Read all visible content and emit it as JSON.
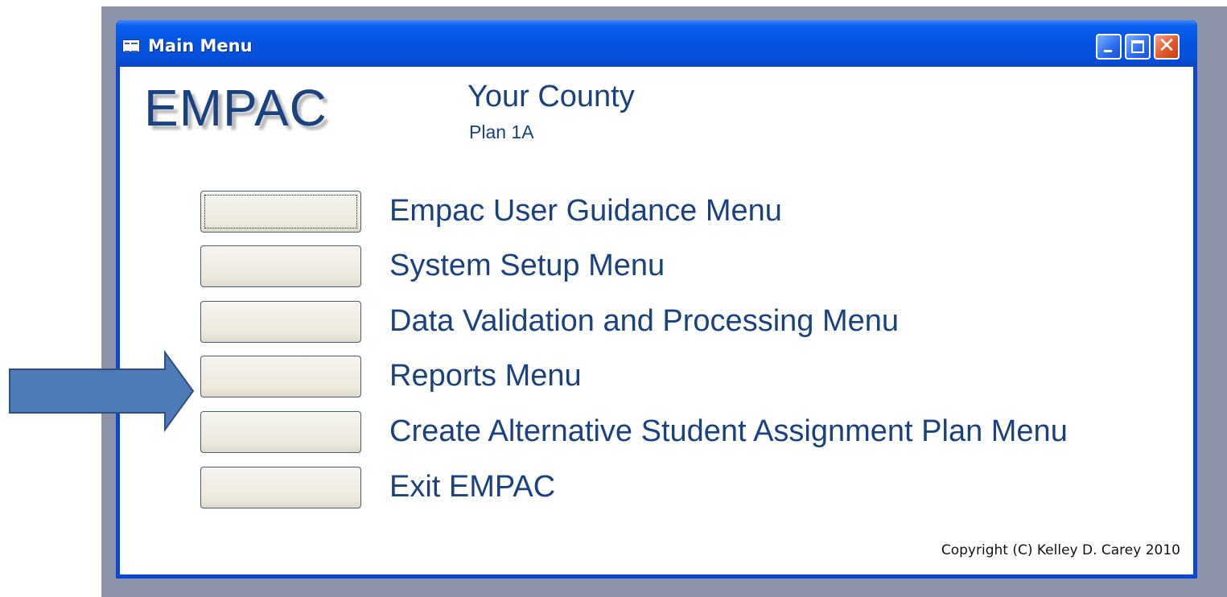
{
  "window": {
    "title": "Main Menu",
    "close_glyph": "✕"
  },
  "header": {
    "logo": "EMPAC",
    "county": "Your County",
    "plan": "Plan 1A"
  },
  "menu": {
    "items": [
      {
        "label": "Empac User Guidance Menu"
      },
      {
        "label": "System Setup Menu"
      },
      {
        "label": "Data Validation and Processing Menu"
      },
      {
        "label": "Reports Menu"
      },
      {
        "label": "Create Alternative Student Assignment Plan Menu"
      },
      {
        "label": "Exit EMPAC"
      }
    ]
  },
  "footer": {
    "copyright": "Copyright (C) Kelley D. Carey 2010"
  },
  "colors": {
    "titlebar": "#0554e3",
    "text_accent": "#1a4280",
    "arrow_fill": "#4f7ab8",
    "arrow_stroke": "#2e4f80"
  },
  "icons": [
    "form-icon",
    "minimize-icon",
    "maximize-icon",
    "close-icon",
    "pointer-arrow-icon"
  ]
}
